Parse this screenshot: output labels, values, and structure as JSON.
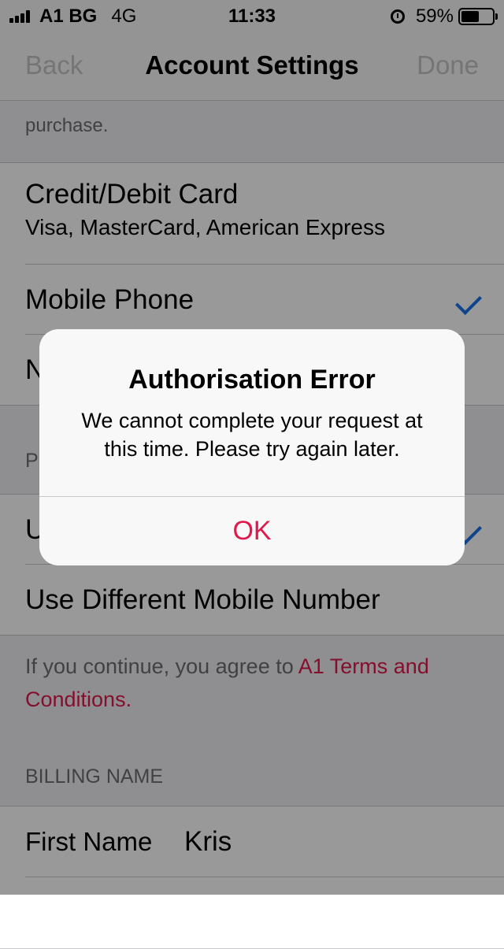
{
  "status_bar": {
    "carrier": "A1 BG",
    "network": "4G",
    "time": "11:33",
    "battery": "59%",
    "battery_level": 0.59
  },
  "nav": {
    "back_label": "Back",
    "title": "Account Settings",
    "done_label": "Done"
  },
  "top_note": "purchase.",
  "payment_methods": [
    {
      "title": "Credit/Debit Card",
      "subtitle": "Visa, MasterCard, American Express",
      "selected": false
    },
    {
      "title": "Mobile Phone",
      "selected": true
    },
    {
      "title": "N",
      "selected": false
    }
  ],
  "phone_section": {
    "header": "P",
    "options": [
      {
        "title": "U",
        "selected": true
      },
      {
        "title": "Use Different Mobile Number",
        "selected": false
      }
    ]
  },
  "terms": {
    "text": "If you continue, you agree to ",
    "link_line1": "A1 Terms and",
    "link_line2": "Conditions."
  },
  "billing": {
    "header": "BILLING NAME",
    "first_name_label": "First Name",
    "first_name_value": "Kris"
  },
  "alert": {
    "title": "Authorisation Error",
    "message": "We cannot complete your request at this time. Please try again later.",
    "ok_label": "OK"
  },
  "colors": {
    "accent": "#e0184c",
    "checkmark": "#1a73e8"
  }
}
